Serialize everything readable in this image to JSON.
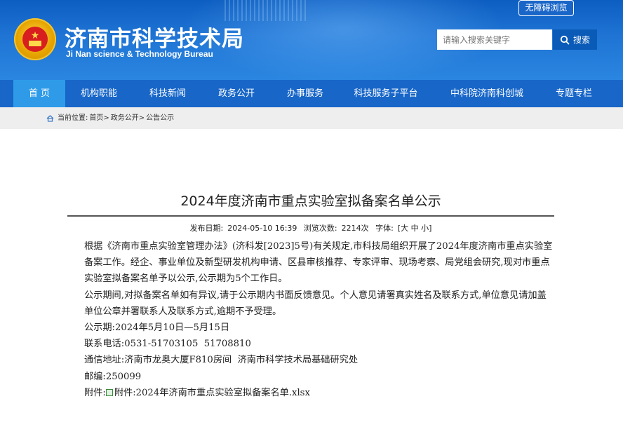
{
  "header": {
    "site_title": "济南市科学技术局",
    "site_title_en": "Ji Nan science & Technology Bureau",
    "accessibility_label": "无障碍浏览",
    "search_placeholder": "请输入搜索关键字",
    "search_button": "搜索",
    "icons": [
      "national-emblem",
      "search-icon"
    ],
    "colors": {
      "header_blue": "#1f74d4",
      "nav_blue": "#1766c8",
      "nav_active": "#2f9be8"
    }
  },
  "nav": {
    "items": [
      "首 页",
      "机构职能",
      "科技新闻",
      "政务公开",
      "办事服务",
      "科技服务子平台",
      "中科院济南科创城",
      "专题专栏"
    ],
    "active_index": 0
  },
  "breadcrumb": {
    "prefix": "当前位置:",
    "items": [
      "首页>",
      "政务公开>",
      "公告公示"
    ],
    "icon": "home-icon"
  },
  "article": {
    "title": "2024年度济南市重点实验室拟备案名单公示",
    "meta": {
      "publish_label": "发布日期:",
      "publish_value": "2024-05-10 16:39",
      "views_label": "浏览次数:",
      "views_value": "2214次",
      "font_label": "字体:",
      "font_options": "[大 中 小]"
    },
    "paragraphs": [
      "根据《济南市重点实验室管理办法》(济科发[2023]5号)有关规定,市科技局组织开展了2024年度济南市重点实验室备案工作。经企、事业单位及新型研发机构申请、区县审核推荐、专家评审、现场考察、局党组会研究,现对市重点实验室拟备案名单予以公示,公示期为5个工作日。",
      "公示期间,对拟备案名单如有异议,请于公示期内书面反馈意见。个人意见请署真实姓名及联系方式,单位意见请加盖单位公章并署联系人及联系方式,逾期不予受理。"
    ],
    "lines": {
      "period": "公示期:2024年5月10日—5月15日",
      "phone": "联系电话:0531-51703105  51708810",
      "address": "通信地址:济南市龙奥大厦F810房间  济南市科学技术局基础研究处",
      "postcode": "邮编:250099",
      "attachment_label": "附件:",
      "attachment_link": "附件:2024年济南市重点实验室拟备案名单.xlsx"
    }
  }
}
